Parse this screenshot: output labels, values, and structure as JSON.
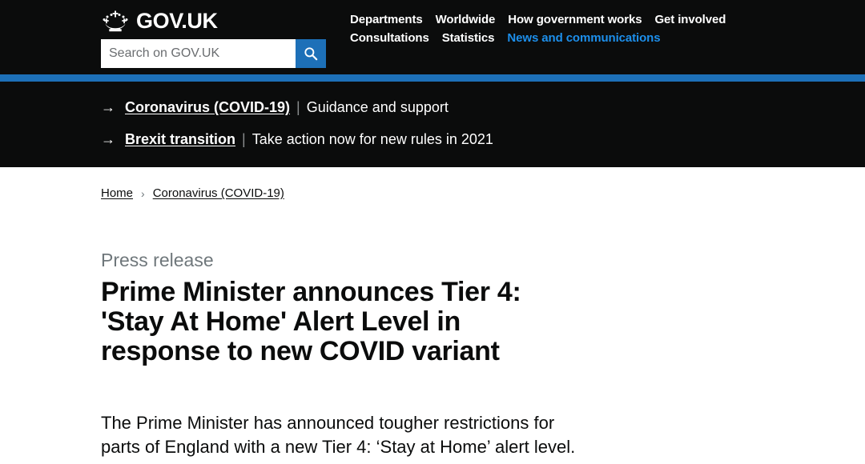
{
  "header": {
    "logo_text": "GOV.UK",
    "logo_icon": "crown-icon",
    "search": {
      "placeholder": "Search on GOV.UK",
      "value": "",
      "button_icon": "search-icon"
    },
    "nav": {
      "row1": [
        {
          "label": "Departments",
          "active": false
        },
        {
          "label": "Worldwide",
          "active": false
        },
        {
          "label": "How government works",
          "active": false
        },
        {
          "label": "Get involved",
          "active": false
        }
      ],
      "row2": [
        {
          "label": "Consultations",
          "active": false
        },
        {
          "label": "Statistics",
          "active": false
        },
        {
          "label": "News and communications",
          "active": true
        }
      ]
    },
    "accent_color": "#1d70b8",
    "active_link_color": "#1d8feb",
    "background_color": "#0b0c0c"
  },
  "banner": {
    "items": [
      {
        "arrow_icon": "arrow-right-icon",
        "link": "Coronavirus (COVID-19)",
        "separator": "|",
        "description": "Guidance and support"
      },
      {
        "arrow_icon": "arrow-right-icon",
        "link": "Brexit transition",
        "separator": "|",
        "description": "Take action now for new rules in 2021"
      }
    ]
  },
  "breadcrumb": {
    "items": [
      {
        "label": "Home"
      },
      {
        "label": "Coronavirus (COVID-19)"
      }
    ],
    "chevron": "›"
  },
  "main": {
    "document_type": "Press release",
    "title": "Prime Minister announces Tier 4: 'Stay At Home' Alert Level in response to new COVID variant",
    "lead": "The Prime Minister has announced tougher restrictions for parts of England with a new Tier 4: ‘Stay at Home’ alert level."
  }
}
